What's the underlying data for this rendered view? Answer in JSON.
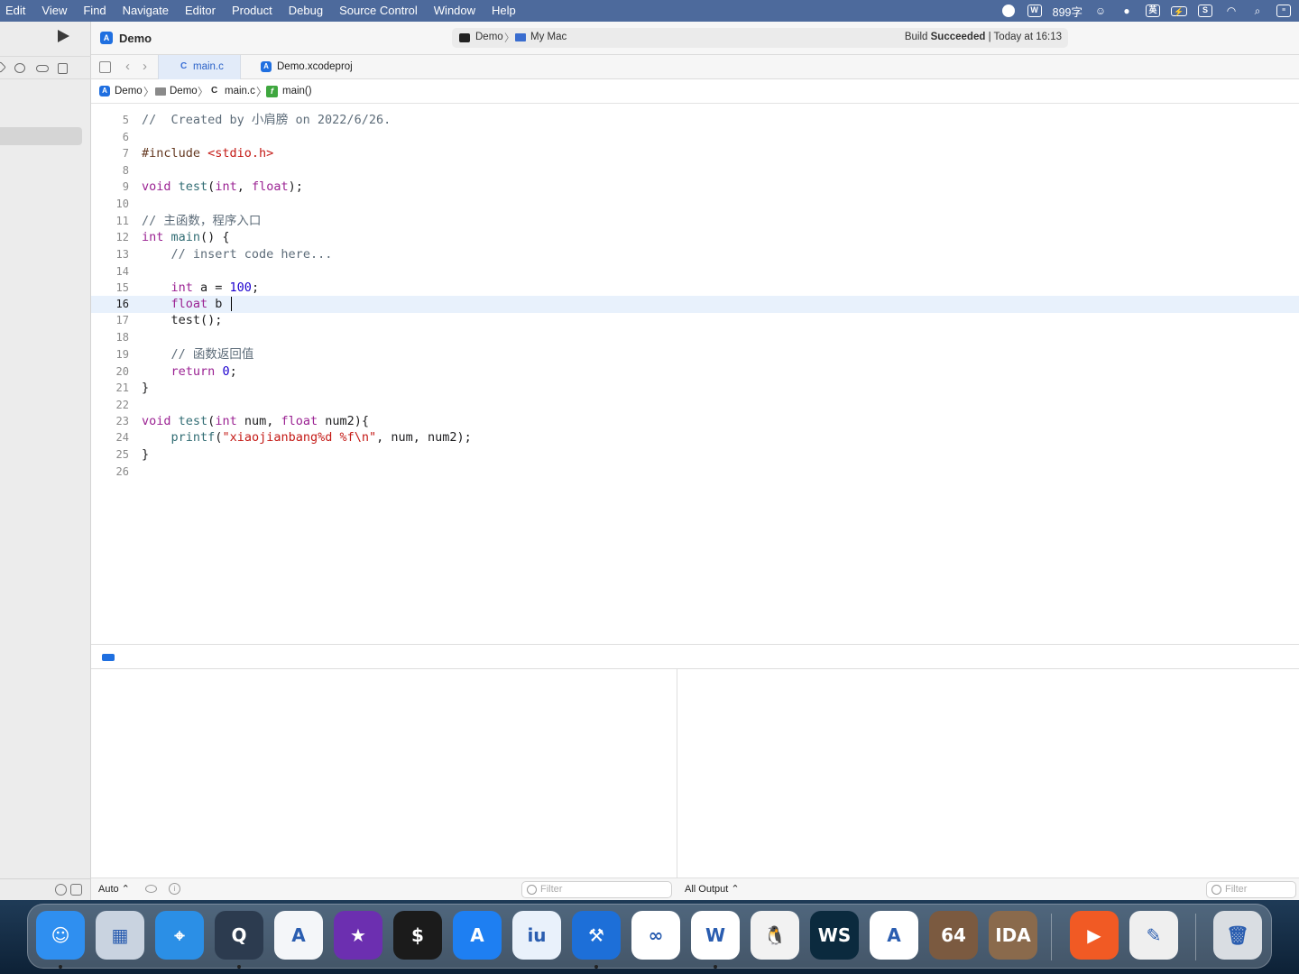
{
  "menubar": {
    "items": [
      "Edit",
      "View",
      "Find",
      "Navigate",
      "Editor",
      "Product",
      "Debug",
      "Source Control",
      "Window",
      "Help"
    ],
    "status": {
      "word_count": "899字",
      "input_method": "英"
    }
  },
  "titlebar": {
    "project": "Demo",
    "scheme": "Demo",
    "destination": "My Mac",
    "build_label": "Build",
    "build_result": "Succeeded",
    "build_time": "| Today at 16:13"
  },
  "tabs": [
    {
      "label": "main.c",
      "icon": "c-file-icon",
      "active": true
    },
    {
      "label": "Demo.xcodeproj",
      "icon": "xcode-project-icon",
      "active": false
    }
  ],
  "jumpbar": {
    "project": "Demo",
    "folder": "Demo",
    "file": "main.c",
    "symbol": "main()"
  },
  "editor": {
    "current_line": 16,
    "lines": [
      {
        "n": "5",
        "segments": [
          {
            "t": "//  Created by 小肩膀 on 2022/6/26.",
            "c": "comment"
          }
        ]
      },
      {
        "n": "6",
        "segments": []
      },
      {
        "n": "7",
        "segments": [
          {
            "t": "#include ",
            "c": "preproc"
          },
          {
            "t": "<stdio.h>",
            "c": "string"
          }
        ]
      },
      {
        "n": "8",
        "segments": []
      },
      {
        "n": "9",
        "segments": [
          {
            "t": "void",
            "c": "keyword"
          },
          {
            "t": " "
          },
          {
            "t": "test",
            "c": "func"
          },
          {
            "t": "("
          },
          {
            "t": "int",
            "c": "keyword"
          },
          {
            "t": ", "
          },
          {
            "t": "float",
            "c": "keyword"
          },
          {
            "t": ");"
          }
        ]
      },
      {
        "n": "10",
        "segments": []
      },
      {
        "n": "11",
        "segments": [
          {
            "t": "// 主函数，程序入口",
            "c": "comment"
          }
        ]
      },
      {
        "n": "12",
        "segments": [
          {
            "t": "int",
            "c": "keyword"
          },
          {
            "t": " "
          },
          {
            "t": "main",
            "c": "func"
          },
          {
            "t": "() {"
          }
        ]
      },
      {
        "n": "13",
        "segments": [
          {
            "t": "    "
          },
          {
            "t": "// insert code here...",
            "c": "comment"
          }
        ]
      },
      {
        "n": "14",
        "segments": []
      },
      {
        "n": "15",
        "segments": [
          {
            "t": "    "
          },
          {
            "t": "int",
            "c": "keyword"
          },
          {
            "t": " a = "
          },
          {
            "t": "100",
            "c": "number"
          },
          {
            "t": ";"
          }
        ]
      },
      {
        "n": "16",
        "segments": [
          {
            "t": "    "
          },
          {
            "t": "float",
            "c": "keyword"
          },
          {
            "t": " b "
          }
        ]
      },
      {
        "n": "17",
        "segments": [
          {
            "t": "    test();"
          }
        ]
      },
      {
        "n": "18",
        "segments": []
      },
      {
        "n": "19",
        "segments": [
          {
            "t": "    "
          },
          {
            "t": "// 函数返回值",
            "c": "comment"
          }
        ]
      },
      {
        "n": "20",
        "segments": [
          {
            "t": "    "
          },
          {
            "t": "return",
            "c": "keyword"
          },
          {
            "t": " "
          },
          {
            "t": "0",
            "c": "number"
          },
          {
            "t": ";"
          }
        ]
      },
      {
        "n": "21",
        "segments": [
          {
            "t": "}"
          }
        ]
      },
      {
        "n": "22",
        "segments": []
      },
      {
        "n": "23",
        "segments": [
          {
            "t": "void",
            "c": "keyword"
          },
          {
            "t": " "
          },
          {
            "t": "test",
            "c": "func"
          },
          {
            "t": "("
          },
          {
            "t": "int",
            "c": "keyword"
          },
          {
            "t": " num, "
          },
          {
            "t": "float",
            "c": "keyword"
          },
          {
            "t": " num2){"
          }
        ]
      },
      {
        "n": "24",
        "segments": [
          {
            "t": "    "
          },
          {
            "t": "printf",
            "c": "func"
          },
          {
            "t": "("
          },
          {
            "t": "\"xiaojianbang%d %f\\n\"",
            "c": "string"
          },
          {
            "t": ", num, num2);"
          }
        ]
      },
      {
        "n": "25",
        "segments": [
          {
            "t": "}"
          }
        ]
      },
      {
        "n": "26",
        "segments": []
      }
    ]
  },
  "debug": {
    "variables_mode": "Auto ⌃",
    "filter_placeholder": "Filter",
    "output_mode": "All Output ⌃"
  },
  "dock": {
    "apps": [
      {
        "name": "finder",
        "color": "#2f8ff0",
        "glyph": "☺",
        "running": true
      },
      {
        "name": "launchpad",
        "color": "#c9d3e0",
        "glyph": "▦",
        "running": false
      },
      {
        "name": "safari",
        "color": "#2b8fe6",
        "glyph": "⌖",
        "running": false
      },
      {
        "name": "quicktime",
        "color": "#2c3b4f",
        "glyph": "Q",
        "running": true
      },
      {
        "name": "ai-app",
        "color": "#f4f6f9",
        "glyph": "A",
        "running": false
      },
      {
        "name": "imovie",
        "color": "#6c2fb0",
        "glyph": "★",
        "running": false
      },
      {
        "name": "terminal",
        "color": "#1b1b1b",
        "glyph": "$",
        "running": false
      },
      {
        "name": "app-store",
        "color": "#1e7ff2",
        "glyph": "A",
        "running": false
      },
      {
        "name": "iu-app",
        "color": "#e9f1fb",
        "glyph": "iu",
        "running": false
      },
      {
        "name": "xcode",
        "color": "#1d6fd8",
        "glyph": "⚒",
        "running": true
      },
      {
        "name": "baidu-netdisk",
        "color": "#ffffff",
        "glyph": "∞",
        "running": false
      },
      {
        "name": "wps-office",
        "color": "#ffffff",
        "glyph": "W",
        "running": true
      },
      {
        "name": "qq",
        "color": "#f2f2f2",
        "glyph": "🐧",
        "running": false
      },
      {
        "name": "webstorm",
        "color": "#0b2a3e",
        "glyph": "WS",
        "running": false
      },
      {
        "name": "android-studio",
        "color": "#ffffff",
        "glyph": "A",
        "running": false
      },
      {
        "name": "ida-64",
        "color": "#7b5a40",
        "glyph": "64",
        "running": false
      },
      {
        "name": "ida",
        "color": "#8a6a4c",
        "glyph": "IDA",
        "running": false
      },
      {
        "name": "presentation-app",
        "color": "#f15a24",
        "glyph": "▶",
        "running": false
      },
      {
        "name": "textedit",
        "color": "#efefef",
        "glyph": "✎",
        "running": false
      },
      {
        "name": "trash",
        "color": "#d9dde2",
        "glyph": "🗑",
        "running": false
      }
    ]
  }
}
